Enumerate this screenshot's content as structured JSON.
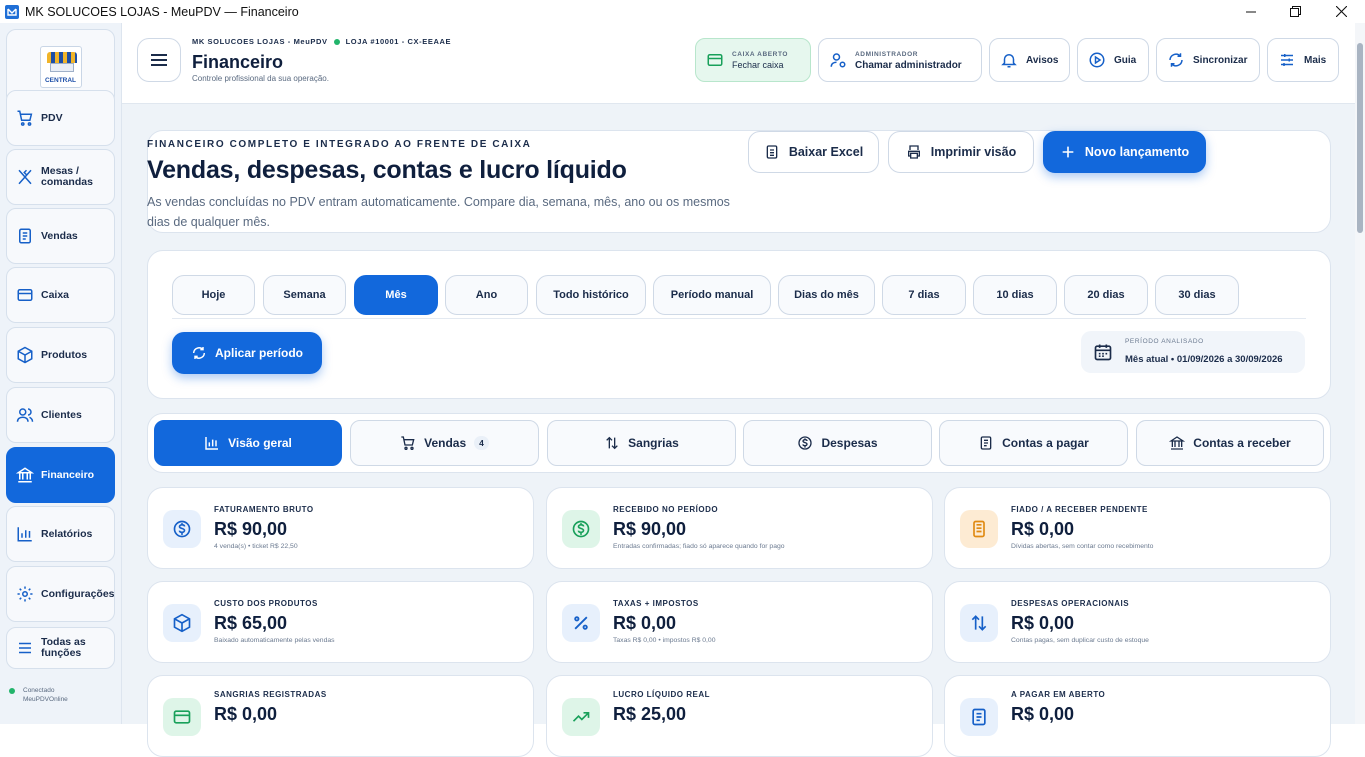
{
  "window": {
    "title": "MK SOLUCOES LOJAS - MeuPDV — Financeiro"
  },
  "logo": {
    "text": "CENTRAL"
  },
  "sidebar": {
    "items": [
      {
        "label": "PDV",
        "icon": "cart-icon"
      },
      {
        "label": "Mesas / comandas",
        "icon": "utensils-icon"
      },
      {
        "label": "Vendas",
        "icon": "document-icon"
      },
      {
        "label": "Caixa",
        "icon": "wallet-icon"
      },
      {
        "label": "Produtos",
        "icon": "box-icon"
      },
      {
        "label": "Clientes",
        "icon": "users-icon"
      },
      {
        "label": "Financeiro",
        "icon": "bank-icon"
      },
      {
        "label": "Relatórios",
        "icon": "bar-chart-icon"
      },
      {
        "label": "Configurações",
        "icon": "gear-icon"
      },
      {
        "label": "Todas as funções",
        "icon": "menu-icon"
      }
    ],
    "status_line1": "Conectado",
    "status_line2": "MeuPDVOnline"
  },
  "header": {
    "store_line": "MK SOLUCOES LOJAS - MeuPDV",
    "store_code": "LOJA #10001 - CX-EEAAE",
    "title": "Financeiro",
    "subtitle": "Controle profissional da sua operação.",
    "caixa_small": "CAIXA ABERTO",
    "caixa_label": "Fechar caixa",
    "admin_small": "ADMINISTRADOR",
    "admin_label": "Chamar administrador",
    "avisos": "Avisos",
    "guia": "Guia",
    "sincronizar": "Sincronizar",
    "mais": "Mais"
  },
  "hero": {
    "eyebrow": "FINANCEIRO COMPLETO E INTEGRADO AO FRENTE DE CAIXA",
    "title": "Vendas, despesas, contas e lucro líquido",
    "description": "As vendas concluídas no PDV entram automaticamente. Compare dia, semana, mês, ano ou os mesmos dias de qualquer mês.",
    "btn_excel": "Baixar Excel",
    "btn_print": "Imprimir visão",
    "btn_new": "Novo lançamento"
  },
  "periods": {
    "buttons": [
      "Hoje",
      "Semana",
      "Mês",
      "Ano",
      "Todo histórico",
      "Período manual",
      "Dias do mês",
      "7 dias",
      "10 dias",
      "20 dias",
      "30 dias"
    ],
    "active": "Mês",
    "apply": "Aplicar período",
    "analyzed_label": "PERÍODO ANALISADO",
    "analyzed_value": "Mês atual • 01/09/2026 a 30/09/2026"
  },
  "sections": {
    "items": [
      {
        "label": "Visão geral",
        "icon": "bar-chart-icon"
      },
      {
        "label": "Vendas",
        "icon": "cart-icon",
        "badge": "4"
      },
      {
        "label": "Sangrias",
        "icon": "arrows-icon"
      },
      {
        "label": "Despesas",
        "icon": "dollar-circle-icon"
      },
      {
        "label": "Contas a pagar",
        "icon": "document-icon"
      },
      {
        "label": "Contas a receber",
        "icon": "bank-icon"
      }
    ],
    "active": "Visão geral"
  },
  "metrics": [
    {
      "label": "FATURAMENTO BRUTO",
      "value": "R$ 90,00",
      "sub": "4 venda(s) • ticket R$ 22,50",
      "icon": "dollar-circle-icon",
      "tone": "blue"
    },
    {
      "label": "RECEBIDO NO PERÍODO",
      "value": "R$ 90,00",
      "sub": "Entradas confirmadas; fiado só aparece quando for pago",
      "icon": "dollar-circle-icon",
      "tone": "green"
    },
    {
      "label": "FIADO / A RECEBER PENDENTE",
      "value": "R$ 0,00",
      "sub": "Dívidas abertas, sem contar como recebimento",
      "icon": "receipt-icon",
      "tone": "orange"
    },
    {
      "label": "CUSTO DOS PRODUTOS",
      "value": "R$ 65,00",
      "sub": "Baixado automaticamente pelas vendas",
      "icon": "box-icon",
      "tone": "blue"
    },
    {
      "label": "TAXAS + IMPOSTOS",
      "value": "R$ 0,00",
      "sub": "Taxas R$ 0,00 • impostos R$ 0,00",
      "icon": "percent-icon",
      "tone": "blue"
    },
    {
      "label": "DESPESAS OPERACIONAIS",
      "value": "R$ 0,00",
      "sub": "Contas pagas, sem duplicar custo de estoque",
      "icon": "arrows-icon",
      "tone": "blue"
    },
    {
      "label": "SANGRIAS REGISTRADAS",
      "value": "R$ 0,00",
      "sub": "",
      "icon": "wallet-icon",
      "tone": "green"
    },
    {
      "label": "LUCRO LÍQUIDO REAL",
      "value": "R$ 25,00",
      "sub": "",
      "icon": "trend-up-icon",
      "tone": "green"
    },
    {
      "label": "A PAGAR EM ABERTO",
      "value": "R$ 0,00",
      "sub": "",
      "icon": "document-icon",
      "tone": "blue"
    }
  ],
  "colors": {
    "accent": "#1268dc",
    "success": "#22b46b",
    "warning": "#e08a12"
  }
}
